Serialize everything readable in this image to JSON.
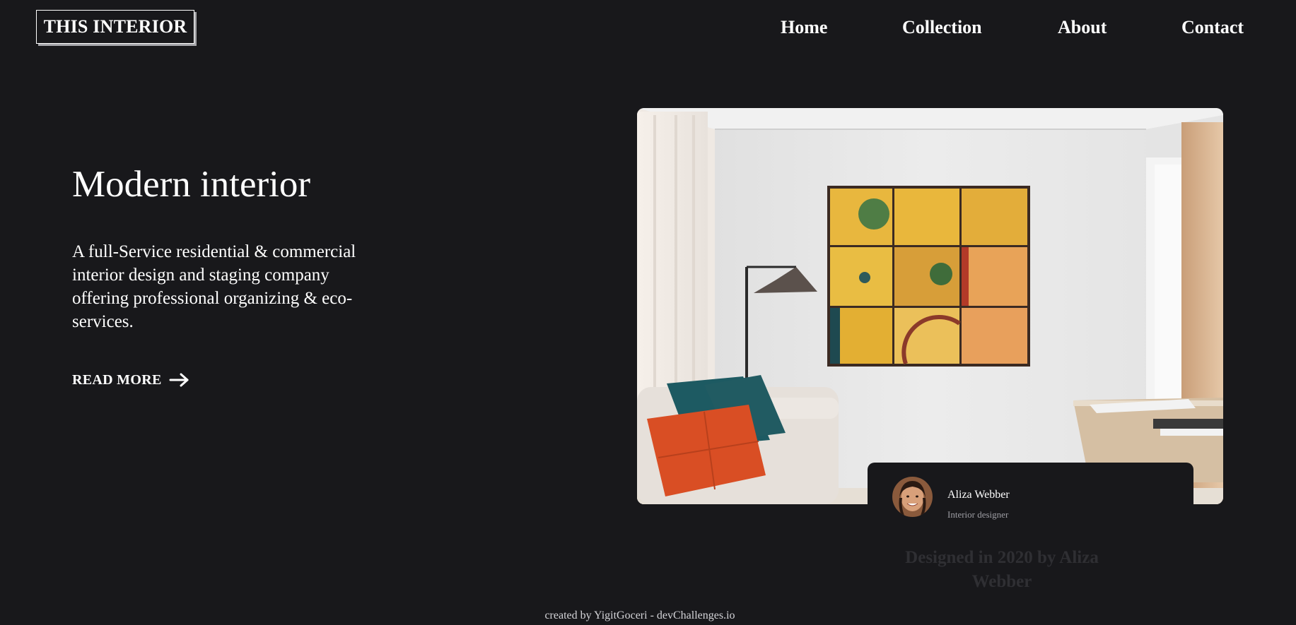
{
  "header": {
    "logo_text": "THIS INTERIOR",
    "nav": [
      {
        "label": "Home"
      },
      {
        "label": "Collection"
      },
      {
        "label": "About"
      },
      {
        "label": "Contact"
      }
    ]
  },
  "hero": {
    "title": "Modern interior",
    "description": "A full-Service residential & commercial interior design and staging company offering professional organizing & eco-services.",
    "cta_label": "READ MORE",
    "cta_icon": "arrow-right-icon"
  },
  "designer": {
    "name": "Aliza Webber",
    "role": "Interior designer",
    "designed_in": "Designed in 2020 by Aliza Webber"
  },
  "footer": {
    "credit": "created by YigitGoceri - devChallenges.io"
  },
  "colors": {
    "background": "#18181b",
    "text": "#ffffff",
    "muted": "#9e9ea4",
    "faded_heading": "#2f2f33"
  }
}
